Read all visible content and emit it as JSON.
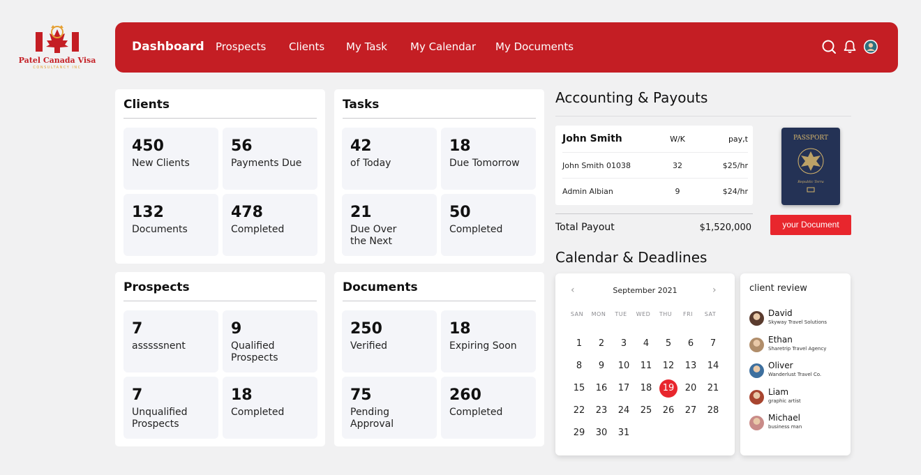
{
  "brand": {
    "name": "Patel Canada Visa",
    "subtitle": "CONSULTANCY INC",
    "primary_color": "#c41e24",
    "accent_color": "#e8262d"
  },
  "nav": {
    "items": [
      {
        "label": "Dashboard",
        "active": true
      },
      {
        "label": "Prospects"
      },
      {
        "label": "Clients"
      },
      {
        "label": "My Task"
      },
      {
        "label": "My Calendar"
      },
      {
        "label": "My Documents"
      }
    ],
    "icons": [
      "search-icon",
      "bell-icon",
      "avatar"
    ]
  },
  "clients": {
    "title": "Clients",
    "tiles": [
      {
        "value": "450",
        "label": "New Clients"
      },
      {
        "value": "56",
        "label": "Payments Due"
      },
      {
        "value": "132",
        "label": "Documents"
      },
      {
        "value": "478",
        "label": "Completed"
      }
    ]
  },
  "tasks": {
    "title": "Tasks",
    "tiles": [
      {
        "value": "42",
        "label": "of Today"
      },
      {
        "value": "18",
        "label": "Due Tomorrow"
      },
      {
        "value": "21",
        "label": "Due Over the Next"
      },
      {
        "value": "50",
        "label": "Completed"
      }
    ]
  },
  "prospects": {
    "title": "Prospects",
    "tiles": [
      {
        "value": "7",
        "label": "asssssnent"
      },
      {
        "value": "9",
        "label": "Qualified Prospects"
      },
      {
        "value": "7",
        "label": "Unqualified Prospects"
      },
      {
        "value": "18",
        "label": "Completed"
      }
    ]
  },
  "documents": {
    "title": "Documents",
    "tiles": [
      {
        "value": "250",
        "label": "Verified"
      },
      {
        "value": "18",
        "label": "Expiring Soon"
      },
      {
        "value": "75",
        "label": "Pending Approval"
      },
      {
        "value": "260",
        "label": "Completed"
      }
    ]
  },
  "accounting": {
    "title": "Accounting & Payouts",
    "header": {
      "name": "John Smith",
      "wk": "W/K",
      "pay": "pay,t"
    },
    "rows": [
      {
        "name": "John Smith 01038",
        "wk": "32",
        "pay": "$25/hr"
      },
      {
        "name": "Admin Albian",
        "wk": "9",
        "pay": "$24/hr"
      }
    ],
    "total_label": "Total Payout",
    "total_value": "$1,520,000",
    "passport_title": "PASSPORT",
    "passport_text": "Republic Terra",
    "document_button": "your Document"
  },
  "calendar": {
    "title": "Calendar & Deadlines",
    "month": "September 2021",
    "weekdays": [
      "SAN",
      "MON",
      "TUE",
      "WED",
      "THU",
      "FRI",
      "SAT"
    ],
    "weeks": [
      [
        "1",
        "2",
        "3",
        "4",
        "5",
        "6",
        "7"
      ],
      [
        "8",
        "9",
        "10",
        "11",
        "12",
        "13",
        "14"
      ],
      [
        "15",
        "16",
        "17",
        "18",
        "19",
        "20",
        "21"
      ],
      [
        "22",
        "23",
        "24",
        "25",
        "26",
        "27",
        "28"
      ],
      [
        "29",
        "30",
        "31"
      ]
    ],
    "selected_day": "19",
    "prev_glyph": "‹",
    "next_glyph": "›"
  },
  "review": {
    "title": "client review",
    "people": [
      {
        "name": "David",
        "sub": "Skyway Travel Solutions",
        "color": "#5a3b2e"
      },
      {
        "name": "Ethan",
        "sub": "Sharetrip Travel Agency",
        "color": "#b08d6a"
      },
      {
        "name": "Oliver",
        "sub": "Wanderlust Travel Co.",
        "color": "#3d6f9e"
      },
      {
        "name": "Liam",
        "sub": "graphic artist",
        "color": "#a8452f"
      },
      {
        "name": "Michael",
        "sub": "business man",
        "color": "#c98b88"
      }
    ]
  }
}
